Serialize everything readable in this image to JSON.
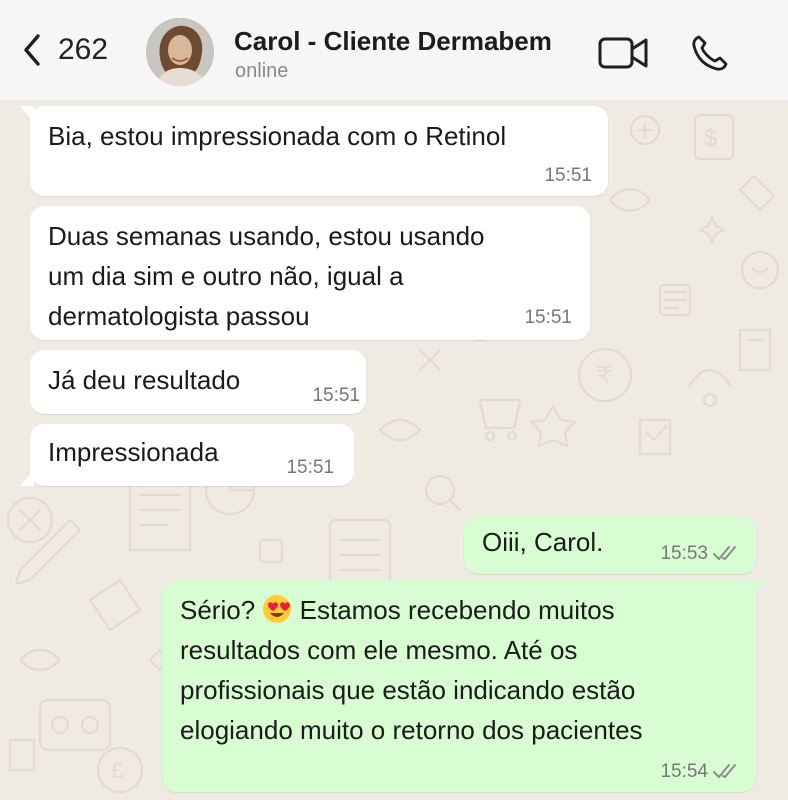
{
  "header": {
    "back_count": "262",
    "contact_name": "Carol - Cliente Dermabem",
    "status": "online"
  },
  "messages": [
    {
      "direction": "in",
      "text": "Bia, estou impressionada com o Retinol",
      "time": "15:51"
    },
    {
      "direction": "in",
      "lines": [
        "Duas semanas usando, estou usando",
        "um dia sim e outro não, igual a",
        "dermatologista passou"
      ],
      "time": "15:51"
    },
    {
      "direction": "in",
      "text": "Já deu resultado",
      "time": "15:51"
    },
    {
      "direction": "in",
      "text": "Impressionada",
      "time": "15:51"
    },
    {
      "direction": "out",
      "text": "Oiii, Carol.",
      "time": "15:53",
      "status": "read"
    },
    {
      "direction": "out",
      "lines": [
        "Sério?",
        "Estamos recebendo muitos",
        "resultados com ele mesmo. Até os",
        "profissionais que estão indicando estão",
        "elogiando muito o retorno dos pacientes"
      ],
      "emoji": "heart-eyes-emoji",
      "time": "15:54",
      "status": "read"
    }
  ],
  "colors": {
    "incoming_bubble": "#ffffff",
    "outgoing_bubble": "#d9fdd3",
    "chat_background": "#efeae2",
    "header_background": "#f6f6f6",
    "read_ticks": "#8c8c8c"
  }
}
